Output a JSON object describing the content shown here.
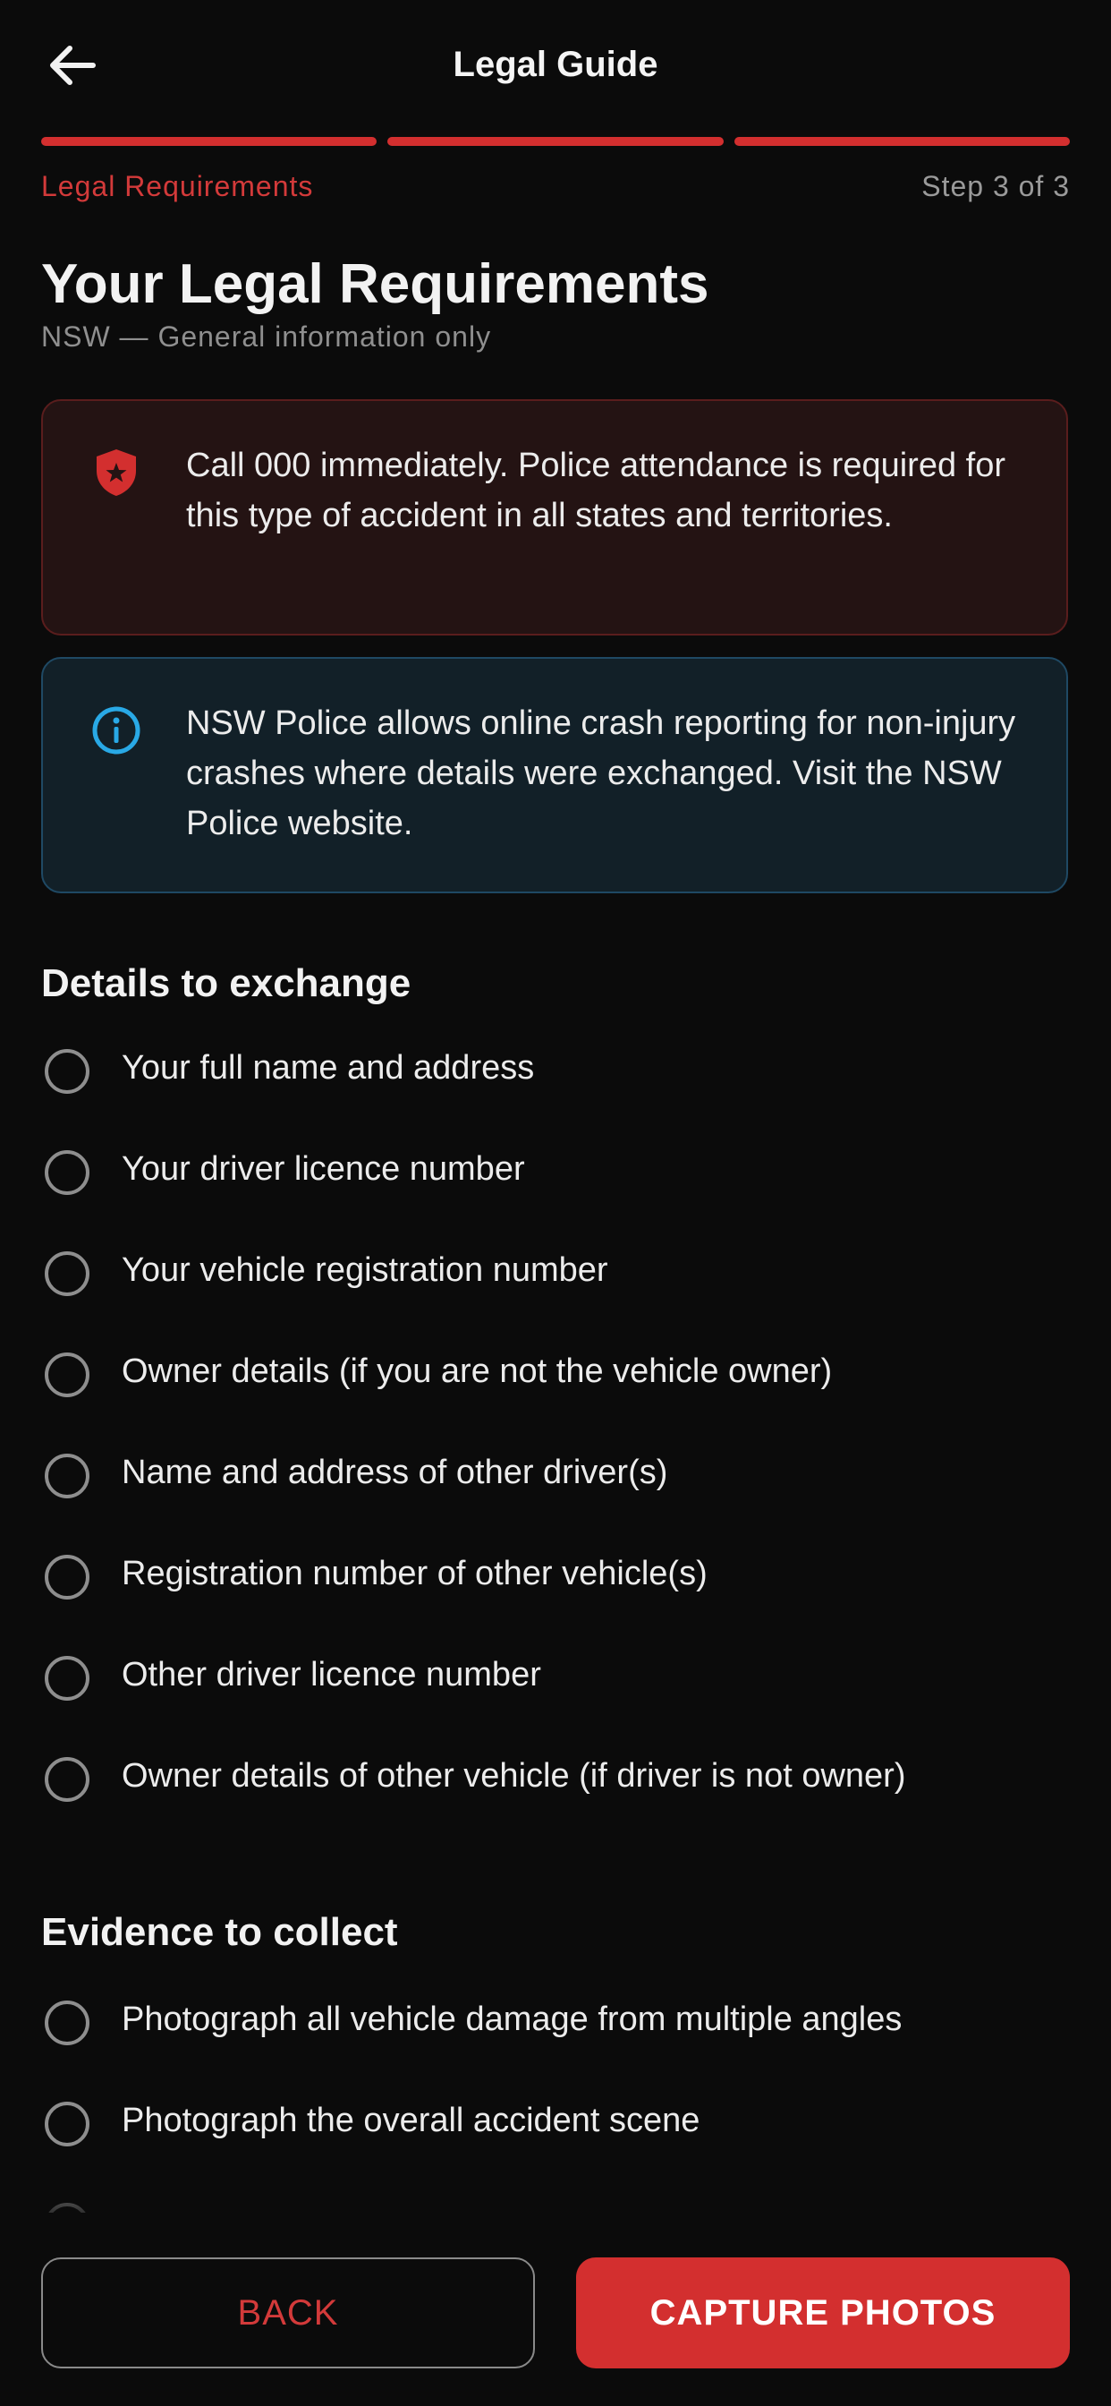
{
  "header": {
    "title": "Legal Guide",
    "back_icon": "arrow-left-icon"
  },
  "progress": {
    "current_step": 3,
    "total_steps": 3
  },
  "step": {
    "label": "Legal Requirements",
    "count": "Step 3 of 3"
  },
  "page": {
    "title": "Your Legal Requirements",
    "subtitle": "NSW — General information only"
  },
  "alerts": {
    "danger": {
      "icon": "police-badge-icon",
      "text": "Call 000 immediately. Police attendance is required for this type of accident in all states and territories.",
      "color": "#d32f2f"
    },
    "info": {
      "icon": "info-icon",
      "text": "NSW Police allows online crash reporting for non-injury crashes where details were exchanged. Visit the NSW Police website.",
      "color": "#29a9e6"
    }
  },
  "details": {
    "heading": "Details to exchange",
    "items": [
      {
        "label": "Your full name and address",
        "checked": false
      },
      {
        "label": "Your driver licence number",
        "checked": false
      },
      {
        "label": "Your vehicle registration number",
        "checked": false
      },
      {
        "label": "Owner details (if you are not the vehicle owner)",
        "checked": false
      },
      {
        "label": "Name and address of other driver(s)",
        "checked": false
      },
      {
        "label": "Registration number of other vehicle(s)",
        "checked": false
      },
      {
        "label": "Other driver licence number",
        "checked": false
      },
      {
        "label": "Owner details of other vehicle (if driver is not owner)",
        "checked": false
      }
    ]
  },
  "evidence": {
    "heading": "Evidence to collect",
    "items": [
      {
        "label": "Photograph all vehicle damage from multiple angles",
        "checked": false
      },
      {
        "label": "Photograph the overall accident scene",
        "checked": false
      }
    ]
  },
  "footer": {
    "back_label": "BACK",
    "primary_label": "CAPTURE PHOTOS"
  },
  "colors": {
    "accent": "#d32f2f",
    "background": "#0b0b0b"
  }
}
